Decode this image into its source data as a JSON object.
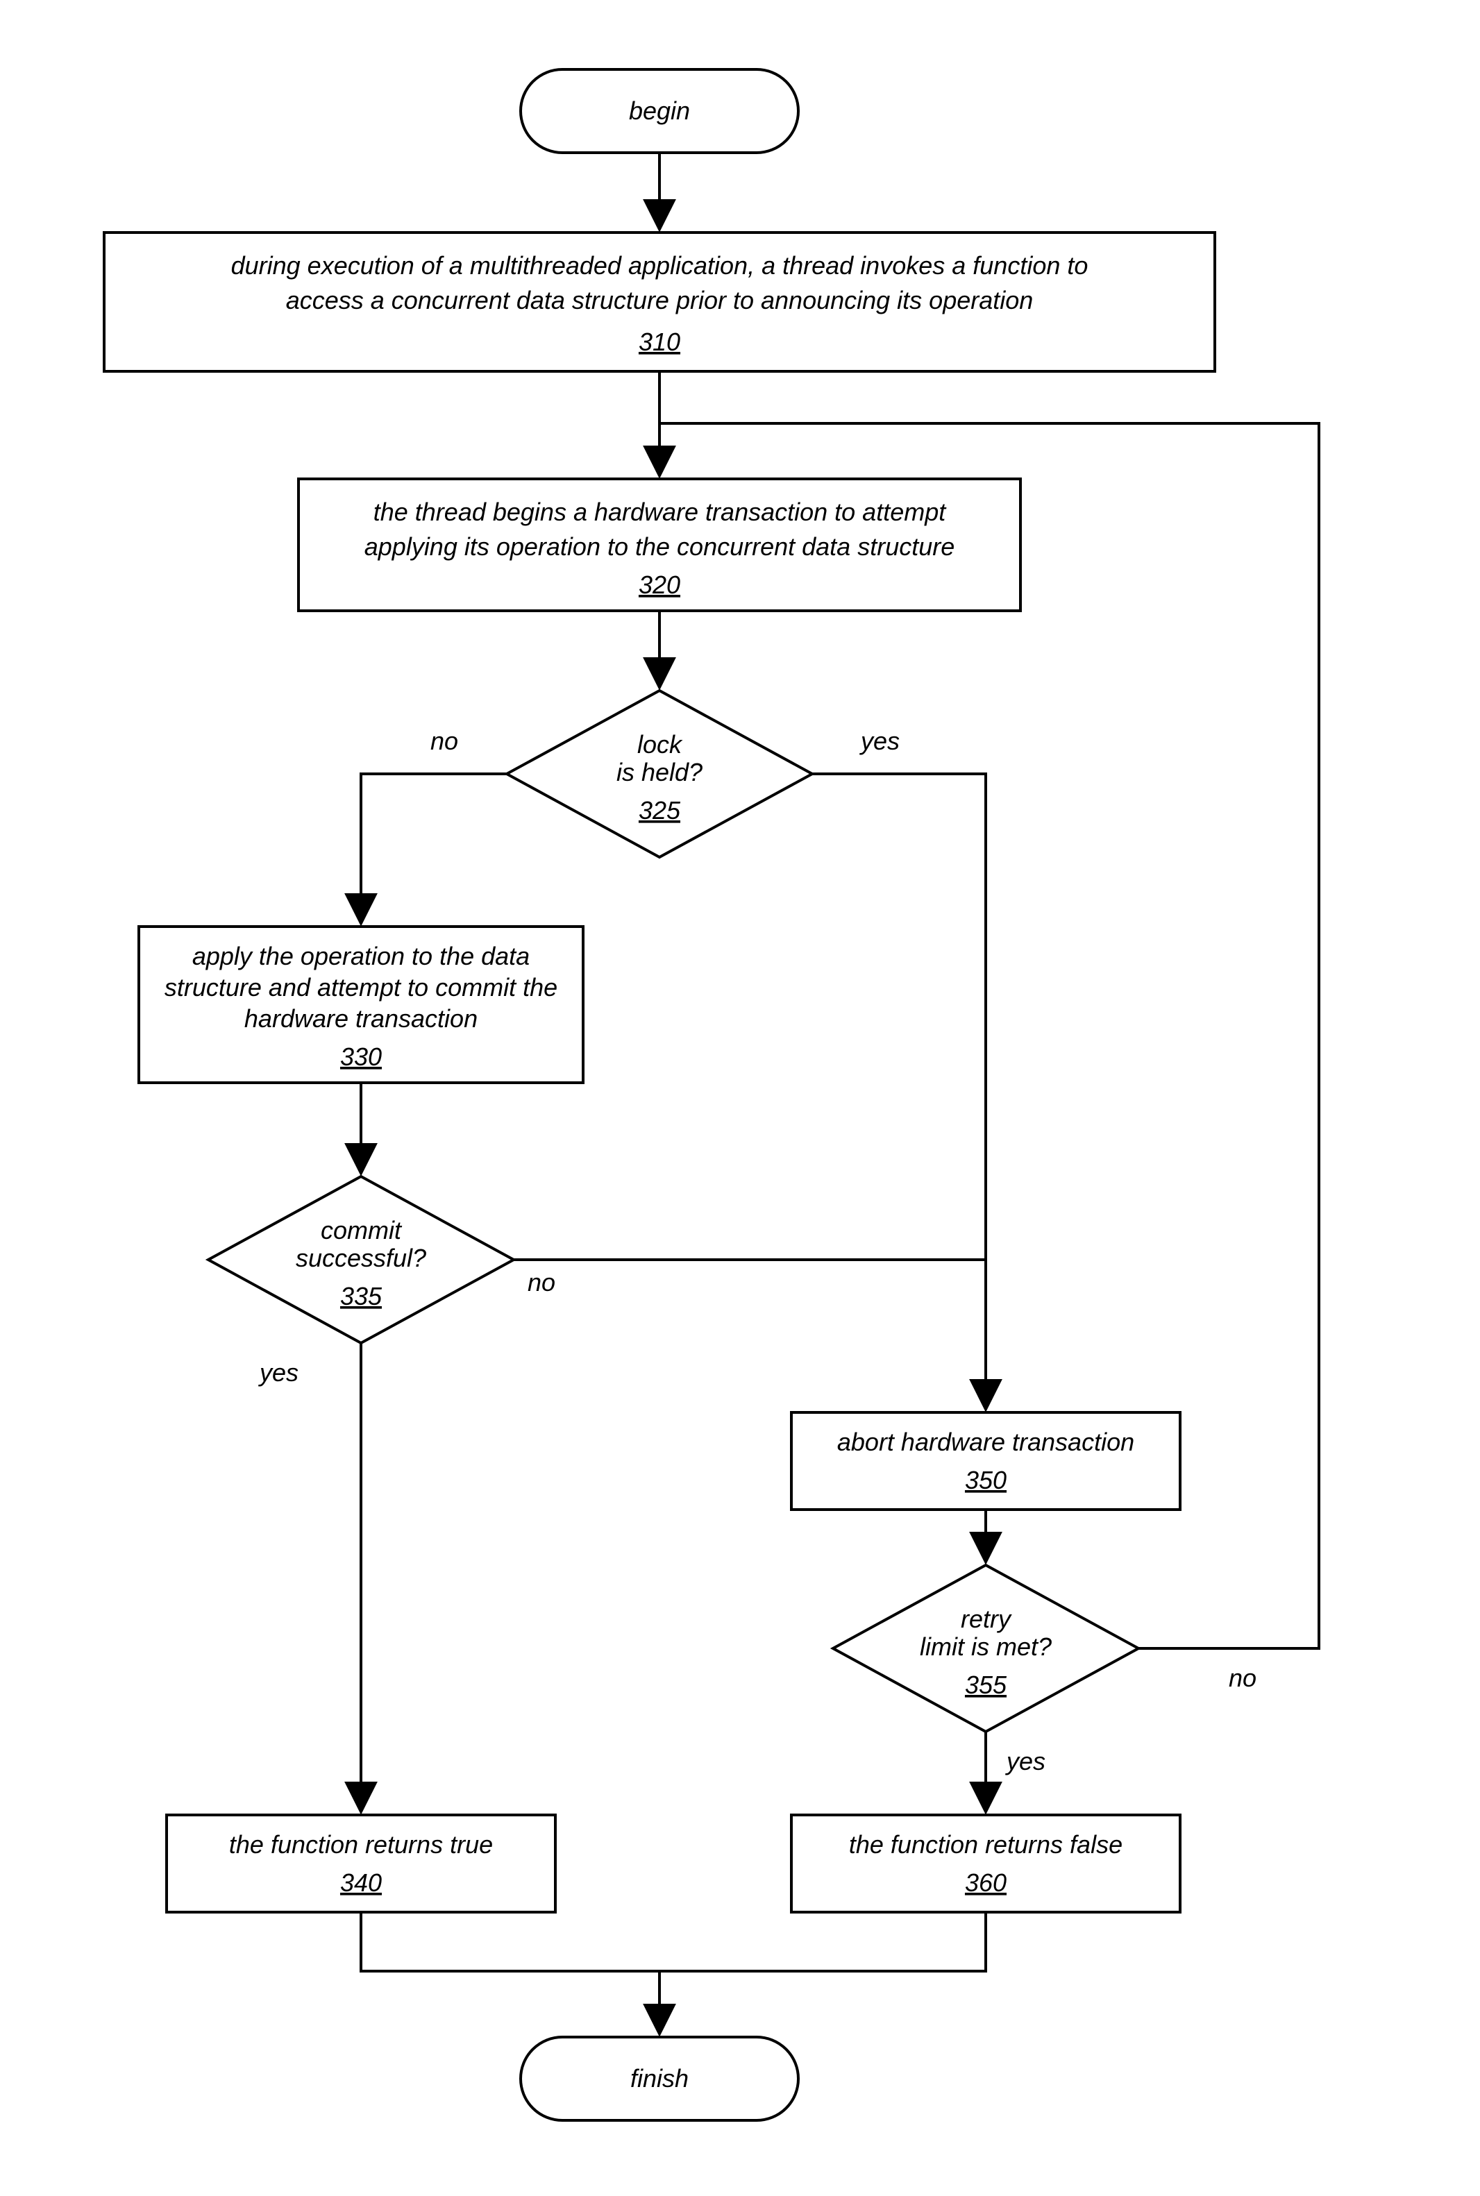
{
  "nodes": {
    "begin": {
      "label": "begin"
    },
    "n310": {
      "l1": "during execution of a multithreaded application, a thread invokes a function to",
      "l2": "access a concurrent data structure prior to announcing its operation",
      "ref": "310"
    },
    "n320": {
      "l1": "the thread begins a hardware transaction to attempt",
      "l2": "applying its operation to the concurrent data structure",
      "ref": "320"
    },
    "n325": {
      "l1": "lock",
      "l2": "is held?",
      "ref": "325"
    },
    "n330": {
      "l1": "apply the operation to the data",
      "l2": "structure and attempt to commit the",
      "l3": "hardware transaction",
      "ref": "330"
    },
    "n335": {
      "l1": "commit",
      "l2": "successful?",
      "ref": "335"
    },
    "n350": {
      "l1": "abort hardware transaction",
      "ref": "350"
    },
    "n355": {
      "l1": "retry",
      "l2": "limit is met?",
      "ref": "355"
    },
    "n340": {
      "l1": "the function returns true",
      "ref": "340"
    },
    "n360": {
      "l1": "the function returns false",
      "ref": "360"
    },
    "finish": {
      "label": "finish"
    }
  },
  "edges": {
    "no": "no",
    "yes": "yes"
  }
}
